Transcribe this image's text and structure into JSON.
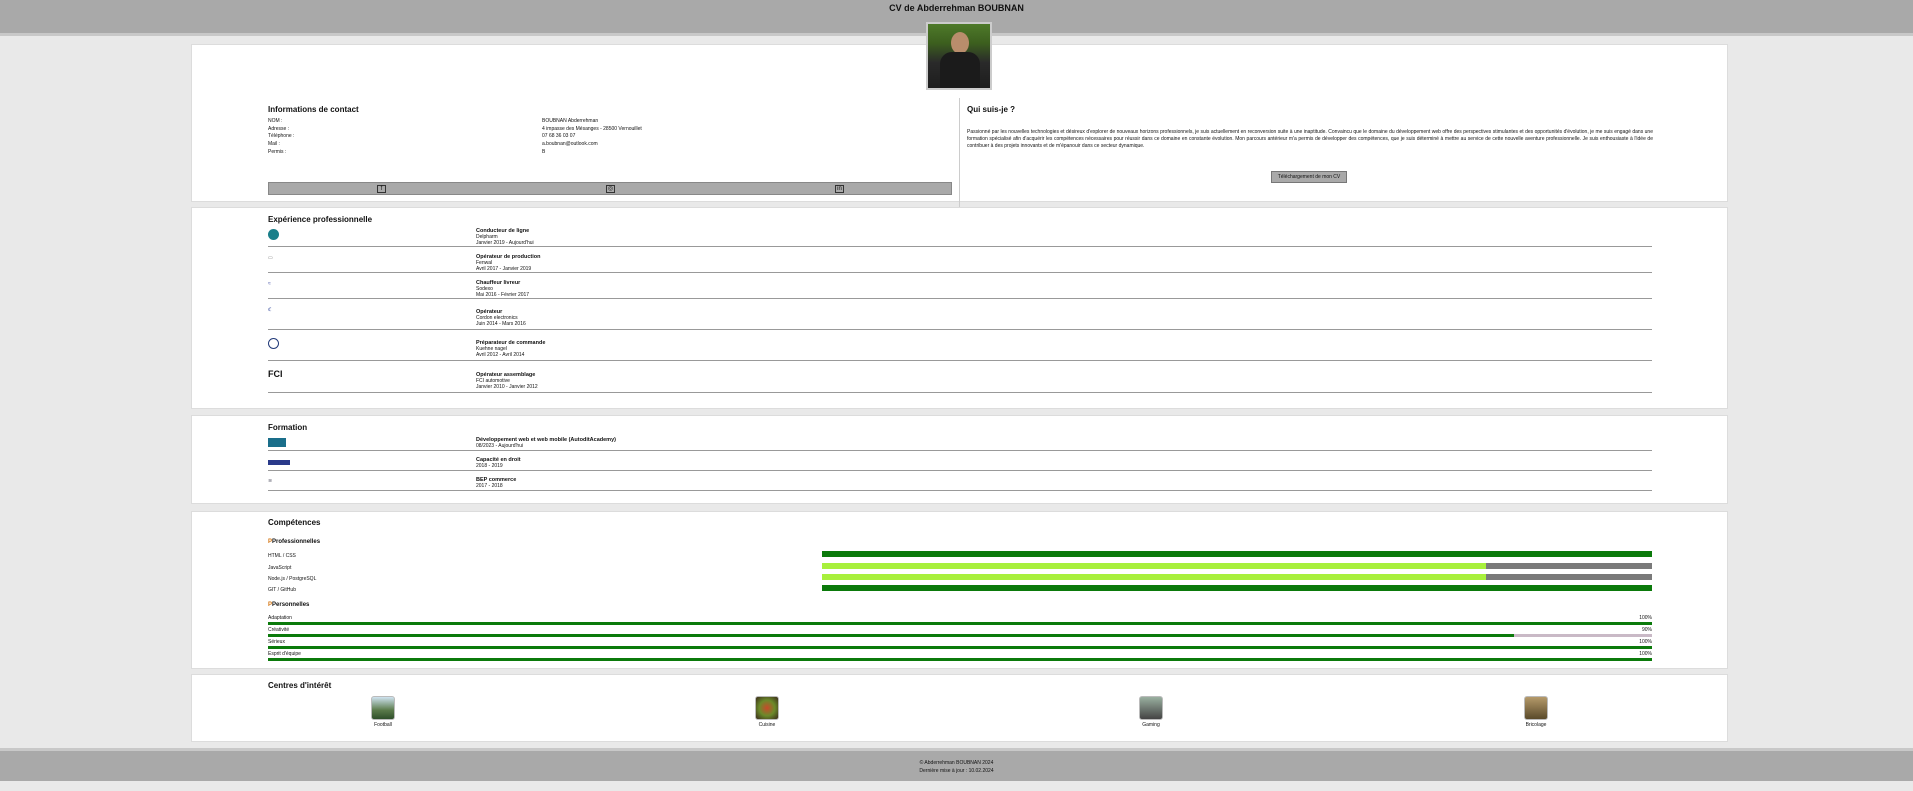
{
  "header": {
    "title": "CV de Abderrehman BOUBNAN"
  },
  "contact": {
    "title": "Informations de contact",
    "labels": [
      "NOM :",
      "Adresse :",
      "Téléphone :",
      "Mail :",
      "Permis :"
    ],
    "values": [
      "BOUBNAN Abderrehman",
      "4 impasse des Mésanges - 28500 Vernouillet",
      "07 68 36 03 07",
      "a.boubnan@outlook.com",
      "B"
    ]
  },
  "social": {
    "icons": [
      "facebook-icon",
      "instagram-icon",
      "linkedin-icon"
    ],
    "glyphs": [
      "f",
      "◎",
      "in"
    ]
  },
  "about": {
    "title": "Qui suis-je ?",
    "text": "Passionné par les nouvelles technologies et désireux d'explorer de nouveaux horizons professionnels, je suis actuellement en reconversion suite à une inaptitude. Convaincu que le domaine du développement web offre des perspectives stimulantes et des opportunités d'évolution, je me suis engagé dans une formation spécialisé afin d'acquérir les compétences nécessaires pour réussir dans ce domaine en constante évolution. Mon parcours antérieur m'a permis de développer des compétences, que je suis déterminé à mettre au service de cette nouvelle aventure professionnelle. Je suis enthousiaste à l'idée de contribuer à des projets innovants et de m'épanouir dans ce secteur dynamique.",
    "button": "Téléchargement de mon CV"
  },
  "experience": {
    "title": "Expérience professionnelle",
    "items": [
      {
        "role": "Conducteur de ligne",
        "company": "Delpharm",
        "dates": "Janvier 2019 - Aujourd'hui"
      },
      {
        "role": "Opérateur de production",
        "company": "Fenwal",
        "dates": "Avril 2017 - Janvier 2019"
      },
      {
        "role": "Chauffeur livreur",
        "company": "Sodexo",
        "dates": "Mai 2016 - Février 2017"
      },
      {
        "role": "Opérateur",
        "company": "Cordon electronics",
        "dates": "Juin 2014 - Mars 2016"
      },
      {
        "role": "Préparateur de commande",
        "company": "Kuehne nagel",
        "dates": "Avril 2012 - Avril 2014"
      },
      {
        "role": "Opérateur assemblage",
        "company": "FCI automotive",
        "dates": "Janvier 2010 - Janvier 2012"
      }
    ]
  },
  "formation": {
    "title": "Formation",
    "items": [
      {
        "title": "Développement web et web mobile (AutoditAcademy)",
        "dates": "08/2023 - Aujourd'hui"
      },
      {
        "title": "Capacité en droit",
        "dates": "2018 - 2019"
      },
      {
        "title": "BEP commerce",
        "dates": "2017 - 2018"
      }
    ]
  },
  "competences": {
    "title": "Compétences",
    "pro_title": "Professionnelles",
    "pro": [
      {
        "name": "HTML / CSS",
        "level": 1.0,
        "color": "#0b7a0b"
      },
      {
        "name": "JavaScript",
        "level": 0.8,
        "color": "#a8f03c"
      },
      {
        "name": "Node.js / PostgreSQL",
        "level": 0.8,
        "color": "#a8f03c"
      },
      {
        "name": "GIT / GitHub",
        "level": 1.0,
        "color": "#0b7a0b"
      }
    ],
    "perso_title": "Personnelles",
    "perso": [
      {
        "name": "Adaptation",
        "pct": "100%",
        "level": 1.0
      },
      {
        "name": "Créativité",
        "pct": "90%",
        "level": 0.9
      },
      {
        "name": "Sérieux",
        "pct": "100%",
        "level": 1.0
      },
      {
        "name": "Esprit d'équipe",
        "pct": "100%",
        "level": 1.0
      }
    ]
  },
  "interests": {
    "title": "Centres d'intérêt",
    "items": [
      "Football",
      "Cuisine",
      "Gaming",
      "Bricolage"
    ]
  },
  "footer": {
    "line1": "© Abderrehman BOUBNAN 2024",
    "line2": "Dernière mise à jour : 10.02.2024"
  }
}
